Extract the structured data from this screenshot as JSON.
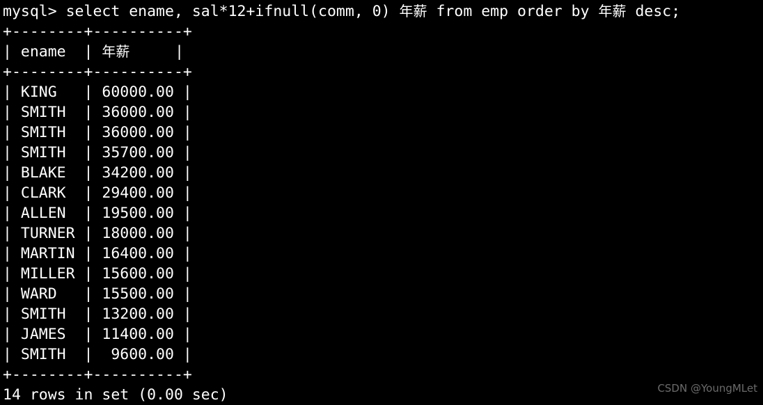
{
  "terminal": {
    "background_color": "#000000",
    "text_color": "#ffffff",
    "prompt": "mysql>",
    "query_line": "mysql> select ename, sal*12+ifnull(comm, 0) 年薪 from emp order by 年薪 desc;",
    "query_parts": {
      "prompt": "mysql> ",
      "before_alias": "select ename, sal*12+ifnull(comm, 0) ",
      "alias_1": "年薪",
      "middle": " from emp order by ",
      "alias_2": "年薪",
      "tail": " desc;"
    },
    "separator_line": "+--------+----------+",
    "header_row": "| ename  | 年薪     |",
    "header_parts": {
      "left": "| ename  | ",
      "cjk": "年薪",
      "right": "     |"
    },
    "columns": [
      "ename",
      "年薪"
    ],
    "rows": [
      {
        "line": "| KING   | 60000.00 |",
        "ename": "KING",
        "annual_salary": "60000.00"
      },
      {
        "line": "| SMITH  | 36000.00 |",
        "ename": "SMITH",
        "annual_salary": "36000.00"
      },
      {
        "line": "| SMITH  | 36000.00 |",
        "ename": "SMITH",
        "annual_salary": "36000.00"
      },
      {
        "line": "| SMITH  | 35700.00 |",
        "ename": "SMITH",
        "annual_salary": "35700.00"
      },
      {
        "line": "| BLAKE  | 34200.00 |",
        "ename": "BLAKE",
        "annual_salary": "34200.00"
      },
      {
        "line": "| CLARK  | 29400.00 |",
        "ename": "CLARK",
        "annual_salary": "29400.00"
      },
      {
        "line": "| ALLEN  | 19500.00 |",
        "ename": "ALLEN",
        "annual_salary": "19500.00"
      },
      {
        "line": "| TURNER | 18000.00 |",
        "ename": "TURNER",
        "annual_salary": "18000.00"
      },
      {
        "line": "| MARTIN | 16400.00 |",
        "ename": "MARTIN",
        "annual_salary": "16400.00"
      },
      {
        "line": "| MILLER | 15600.00 |",
        "ename": "MILLER",
        "annual_salary": "15600.00"
      },
      {
        "line": "| WARD   | 15500.00 |",
        "ename": "WARD",
        "annual_salary": "15500.00"
      },
      {
        "line": "| SMITH  | 13200.00 |",
        "ename": "SMITH",
        "annual_salary": "13200.00"
      },
      {
        "line": "| JAMES  | 11400.00 |",
        "ename": "JAMES",
        "annual_salary": "11400.00"
      },
      {
        "line": "| SMITH  |  9600.00 |",
        "ename": "SMITH",
        "annual_salary": "9600.00"
      }
    ],
    "result_summary": "14 rows in set (0.00 sec)",
    "row_count": 14,
    "elapsed": "0.00 sec"
  },
  "watermark": {
    "text": "CSDN @YoungMLet",
    "color": "#6b6b6b"
  }
}
